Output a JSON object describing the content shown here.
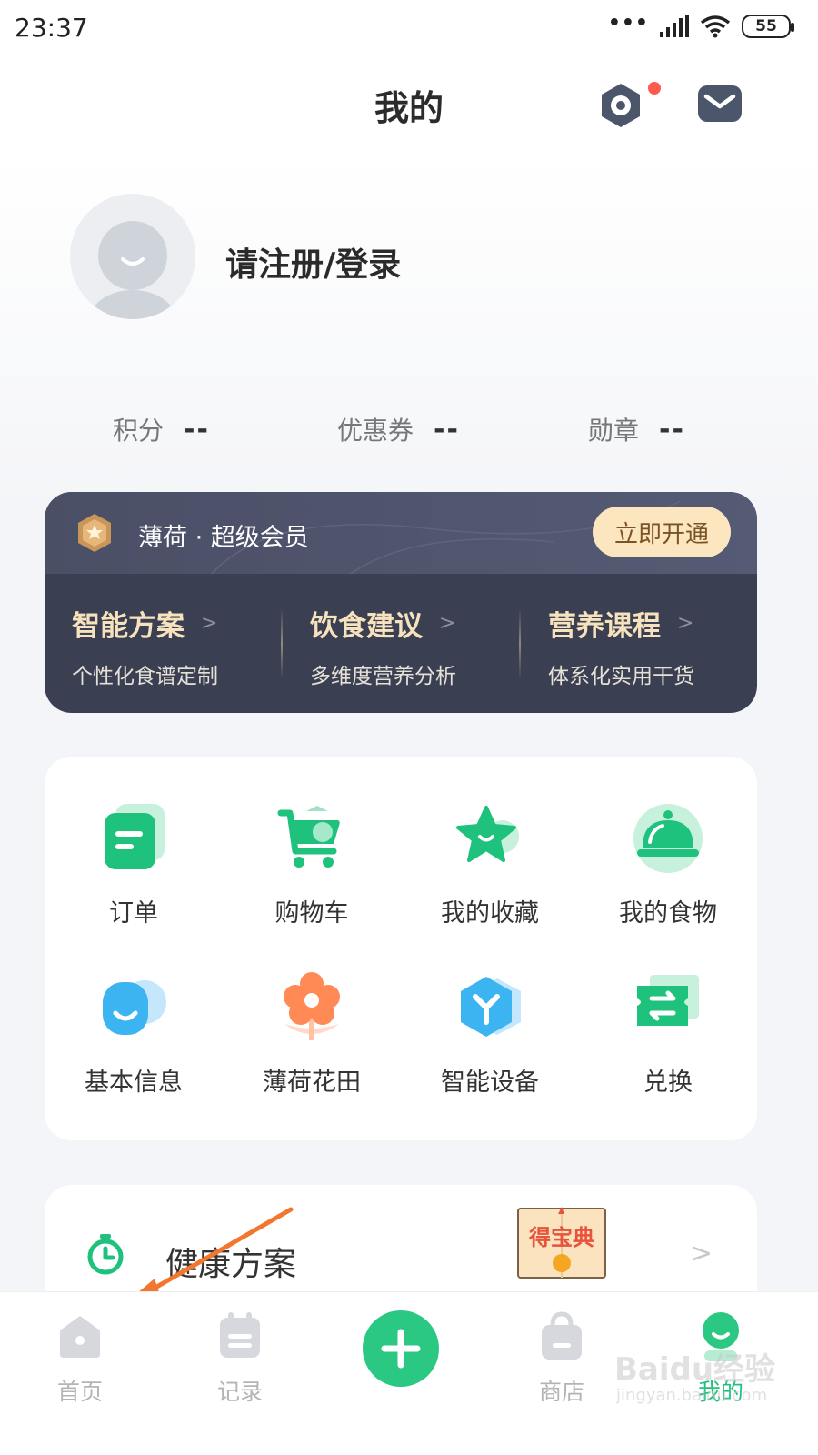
{
  "status_bar": {
    "time": "23:37",
    "signal_dots": "•••",
    "battery": "55"
  },
  "header": {
    "title": "我的"
  },
  "profile": {
    "login_prompt": "请注册/登录"
  },
  "stats": [
    {
      "label": "积分",
      "value": "--"
    },
    {
      "label": "优惠券",
      "value": "--"
    },
    {
      "label": "勋章",
      "value": "--"
    }
  ],
  "vip": {
    "title": "薄荷 · 超级会员",
    "open_button": "立即开通",
    "features": [
      {
        "title": "智能方案",
        "subtitle": "个性化食谱定制"
      },
      {
        "title": "饮食建议",
        "subtitle": "多维度营养分析"
      },
      {
        "title": "营养课程",
        "subtitle": "体系化实用干货"
      }
    ],
    "chevron": ">"
  },
  "grid": [
    {
      "label": "订单",
      "icon": "order-icon"
    },
    {
      "label": "购物车",
      "icon": "cart-icon"
    },
    {
      "label": "我的收藏",
      "icon": "favorite-star-icon"
    },
    {
      "label": "我的食物",
      "icon": "food-cloche-icon"
    },
    {
      "label": "基本信息",
      "icon": "profile-info-icon"
    },
    {
      "label": "薄荷花田",
      "icon": "flower-icon"
    },
    {
      "label": "智能设备",
      "icon": "smart-device-icon"
    },
    {
      "label": "兑换",
      "icon": "exchange-ticket-icon"
    }
  ],
  "health": {
    "label": "健康方案",
    "book_text": "得宝典",
    "chevron": ">"
  },
  "bottom_nav": [
    {
      "label": "首页",
      "icon": "home-icon"
    },
    {
      "label": "记录",
      "icon": "record-icon"
    },
    {
      "label": "",
      "icon": "add-icon"
    },
    {
      "label": "商店",
      "icon": "shop-bag-icon"
    },
    {
      "label": "我的",
      "icon": "mine-avatar-icon",
      "active": true
    }
  ],
  "watermark": {
    "main": "Baidu经验",
    "sub": "jingyan.baidu.com"
  },
  "colors": {
    "accent_green": "#2bc884",
    "vip_bg": "#3b3f52",
    "vip_gold": "#fbe6bf"
  }
}
